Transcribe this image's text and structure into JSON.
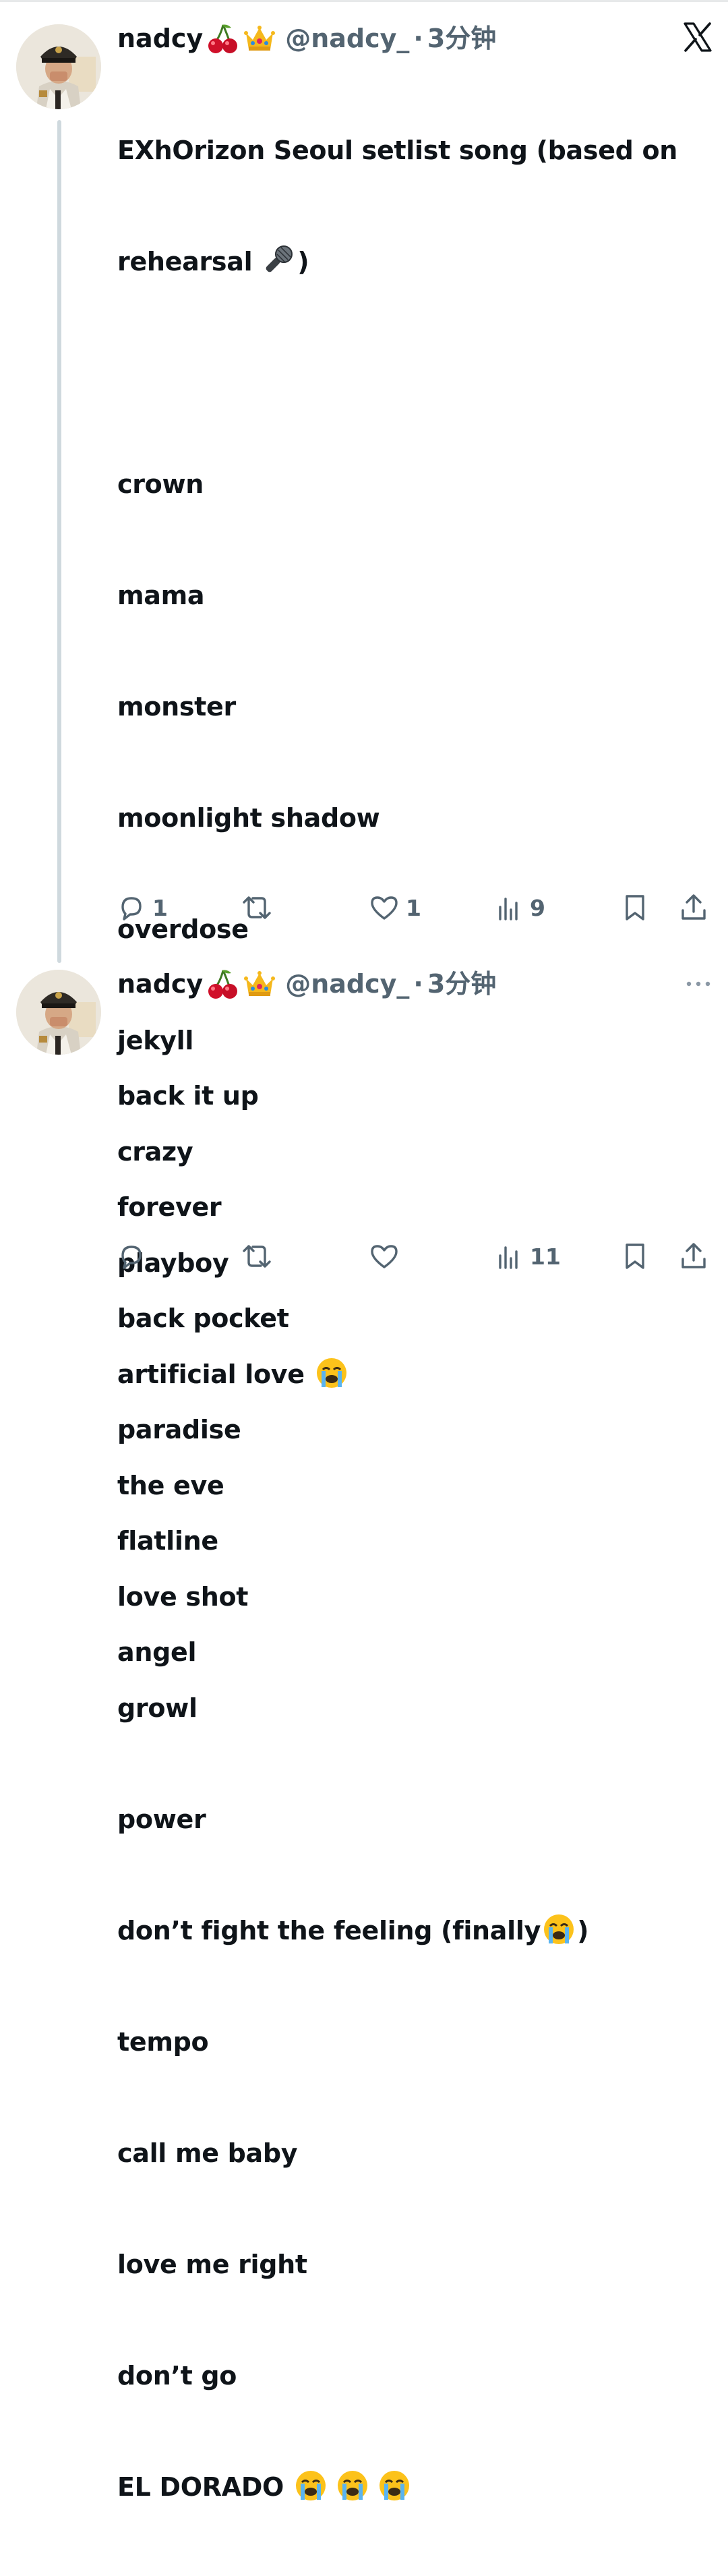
{
  "tweets": [
    {
      "name": "nadcy",
      "name_emojis": [
        "cherries-emoji",
        "crown-emoji"
      ],
      "handle": "@nadcy_",
      "separator": "·",
      "time": "3分钟",
      "corner_icon": "x-logo-icon",
      "lines": [
        "EXhOrizon Seoul setlist song (based on",
        "rehearsal ",
        "",
        "crown",
        "mama",
        "monster",
        "moonlight shadow",
        "overdose",
        "jekyll",
        "crazy",
        "playboy",
        "artificial love ",
        "the eve",
        "love shot",
        "growl",
        "power",
        "don’t fight the feeling (finally",
        "tempo",
        "call me baby",
        "love me right",
        "don’t go",
        "EL DORADO "
      ],
      "line_suffix": {
        "rehearsal_close": ")",
        "finally_close": ")"
      },
      "actions": {
        "reply": "1",
        "retweet": "",
        "like": "1",
        "views": "9"
      }
    },
    {
      "name": "nadcy",
      "name_emojis": [
        "cherries-emoji",
        "crown-emoji"
      ],
      "handle": "@nadcy_",
      "separator": "·",
      "time": "3分钟",
      "corner_icon": "more-options-icon",
      "lines": [
        "back it up",
        "forever",
        "back pocket",
        "paradise",
        "flatline",
        "angel"
      ],
      "actions": {
        "reply": "",
        "retweet": "",
        "like": "",
        "views": "11"
      }
    }
  ],
  "colors": {
    "text": "#0f1419",
    "secondary": "#536471",
    "thread_line": "#cfd9de"
  }
}
